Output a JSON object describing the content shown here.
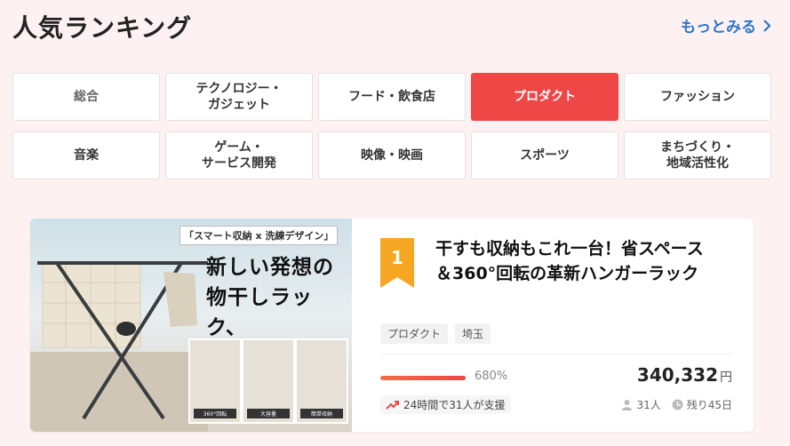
{
  "header": {
    "title": "人気ランキング",
    "more_label": "もっとみる"
  },
  "categories": [
    {
      "label": "総合",
      "active": false
    },
    {
      "label": "テクノロジー・\nガジェット",
      "active": false
    },
    {
      "label": "フード・飲食店",
      "active": false
    },
    {
      "label": "プロダクト",
      "active": true
    },
    {
      "label": "ファッション",
      "active": false
    },
    {
      "label": "音楽",
      "active": false
    },
    {
      "label": "ゲーム・\nサービス開発",
      "active": false
    },
    {
      "label": "映像・映画",
      "active": false
    },
    {
      "label": "スポーツ",
      "active": false
    },
    {
      "label": "まちづくり・\n地域活性化",
      "active": false
    }
  ],
  "project": {
    "rank": "1",
    "title": "干すも収納もこれ一台！省スペース\n＆360°回転の革新ハンガーラック",
    "image": {
      "tag": "「スマート収納 x 洗練デザイン」",
      "headline": "新しい発想の\n物干しラック、\nついに登場！",
      "captions": [
        "360°回転",
        "大容量",
        "簡単収納"
      ]
    },
    "tags": [
      "プロダクト",
      "埼玉"
    ],
    "progress_percent": 680,
    "progress_label": "680%",
    "amount": "340,332",
    "currency": "円",
    "support_text": "24時間で31人が支援",
    "supporters": "31人",
    "remaining": "残り45日"
  },
  "colors": {
    "accent": "#ef4646",
    "link": "#2d77c8",
    "rank_badge": "#f5a623",
    "background": "#fdf2f1"
  }
}
